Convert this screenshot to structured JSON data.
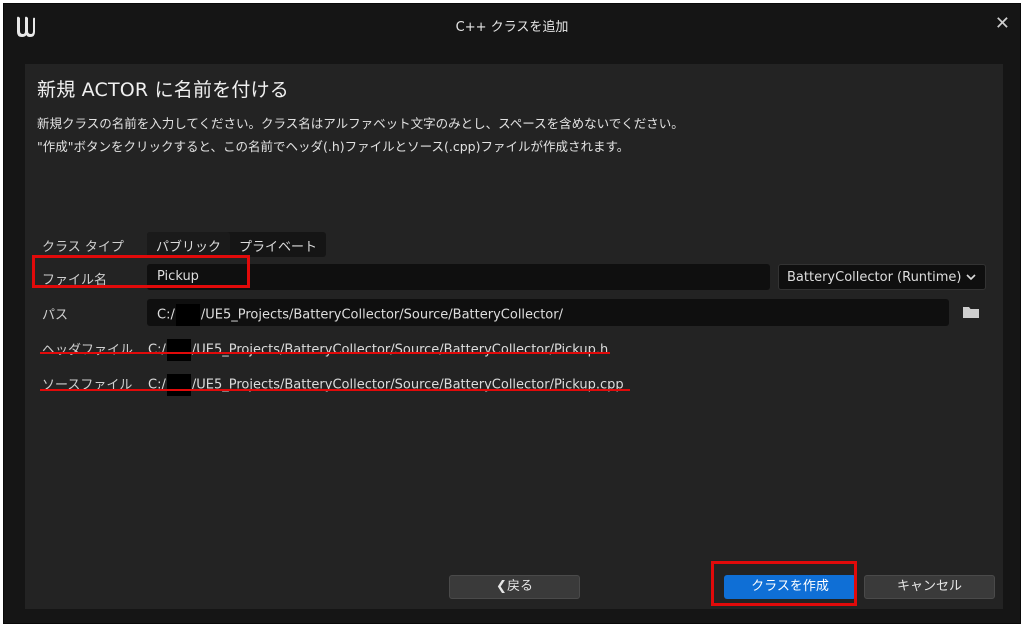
{
  "window": {
    "title": "C++ クラスを追加",
    "close_glyph": "✕"
  },
  "dialog": {
    "heading": "新規 ACTOR に名前を付ける",
    "desc1": "新規クラスの名前を入力してください。クラス名はアルファベット文字のみとし、スペースを含めないでください。",
    "desc2": "\"作成\"ボタンをクリックすると、この名前でヘッダ(.h)ファイルとソース(.cpp)ファイルが作成されます。"
  },
  "form": {
    "class_type_label": "クラス タイプ",
    "class_type_options": [
      "パブリック",
      "プライベート"
    ],
    "file_name_label": "ファイル名",
    "file_name_value": "Pickup",
    "module_value": "BatteryCollector (Runtime)",
    "path_label": "パス",
    "path_prefix": "C:/",
    "path_suffix": "/UE5_Projects/BatteryCollector/Source/BatteryCollector/",
    "header_label": "ヘッダファイル",
    "header_prefix": "C:/",
    "header_suffix": "/UE5_Projects/BatteryCollector/Source/BatteryCollector/Pickup.h",
    "source_label": "ソースファイル",
    "source_prefix": "C:/",
    "source_suffix": "/UE5_Projects/BatteryCollector/Source/BatteryCollector/Pickup.cpp"
  },
  "buttons": {
    "back": "戻る",
    "back_glyph": "❮",
    "create": "クラスを作成",
    "cancel": "キャンセル"
  },
  "colors": {
    "accent": "#0f6fd6",
    "highlight": "#e10a0a",
    "panel": "#232323"
  }
}
